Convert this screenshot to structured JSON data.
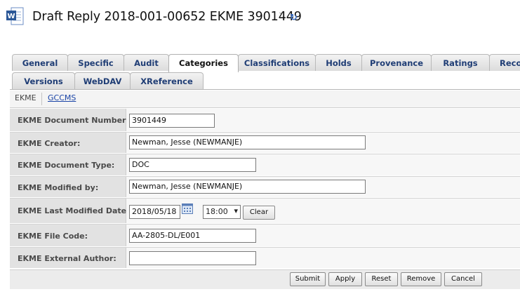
{
  "header": {
    "title": "Draft Reply 2018-001-00652 EKME 3901449",
    "caret": "˅",
    "refresh": "↻",
    "icon_letter": "W"
  },
  "tabs": {
    "row1": [
      "General",
      "Specific",
      "Audit",
      "Categories",
      "Classifications",
      "Holds",
      "Provenance",
      "Ratings",
      "Reco"
    ],
    "row2": [
      "Versions",
      "WebDAV",
      "XReference"
    ],
    "active": "Categories"
  },
  "subtabs": {
    "active": "EKME",
    "link": "GCCMS"
  },
  "form": {
    "document_number": {
      "label": "EKME Document Number:",
      "value": "3901449"
    },
    "creator": {
      "label": "EKME Creator:",
      "value": "Newman, Jesse (NEWMANJE)"
    },
    "document_type": {
      "label": "EKME Document Type:",
      "value": "DOC"
    },
    "modified_by": {
      "label": "EKME Modified by:",
      "value": "Newman, Jesse (NEWMANJE)"
    },
    "last_modified_date": {
      "label": "EKME Last Modified Date:",
      "date": "2018/05/18",
      "time": "18:00",
      "clear": "Clear"
    },
    "file_code": {
      "label": "EKME File Code:",
      "value": "AA-2805-DL/E001"
    },
    "external_author": {
      "label": "EKME External Author:",
      "value": ""
    }
  },
  "buttons": {
    "submit": "Submit",
    "apply": "Apply",
    "reset": "Reset",
    "remove": "Remove",
    "cancel": "Cancel"
  },
  "colors": {
    "tab_text": "#1f3d75",
    "link": "#1a44a6",
    "label_bg": "#e2e2e2"
  }
}
